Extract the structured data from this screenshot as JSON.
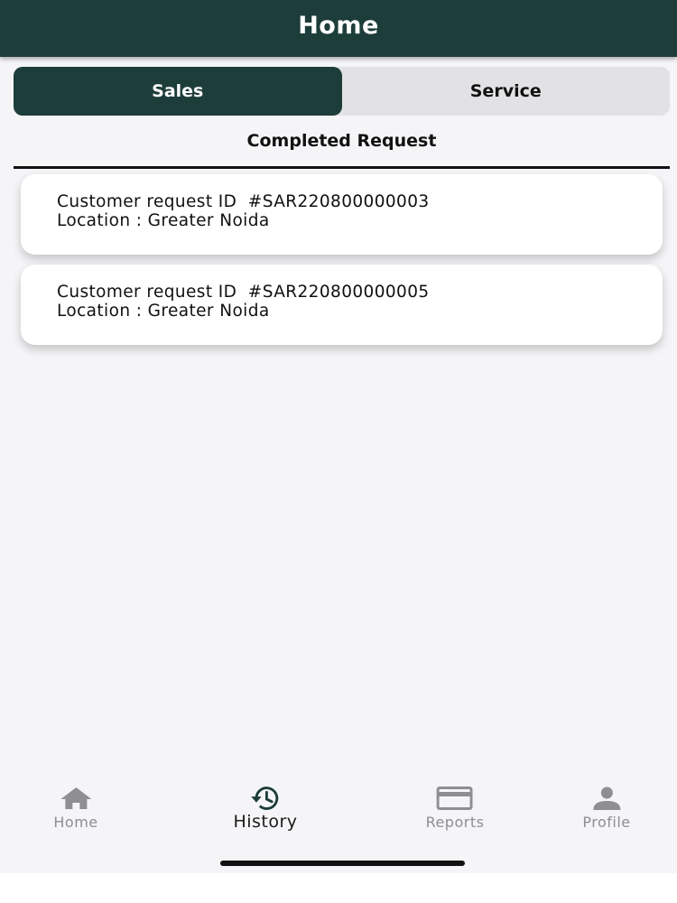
{
  "header": {
    "title": "Home"
  },
  "segments": [
    {
      "label": "Sales",
      "active": true
    },
    {
      "label": "Service",
      "active": false
    }
  ],
  "section_title": "Completed Request",
  "requests": [
    {
      "id_line": "Customer request ID  #SAR220800000003",
      "location_line": "Location : Greater Noida"
    },
    {
      "id_line": "Customer request ID  #SAR220800000005",
      "location_line": "Location : Greater Noida"
    }
  ],
  "tabbar": {
    "items": [
      {
        "label": "Home",
        "icon": "home-icon",
        "active": false
      },
      {
        "label": "History",
        "icon": "history-icon",
        "active": true
      },
      {
        "label": "Reports",
        "icon": "credit-card-icon",
        "active": false
      },
      {
        "label": "Profile",
        "icon": "person-icon",
        "active": false
      }
    ]
  },
  "colors": {
    "primary": "#1d3d3a",
    "inactive": "#8e8e93",
    "segment_bg": "#e2e2e4"
  }
}
